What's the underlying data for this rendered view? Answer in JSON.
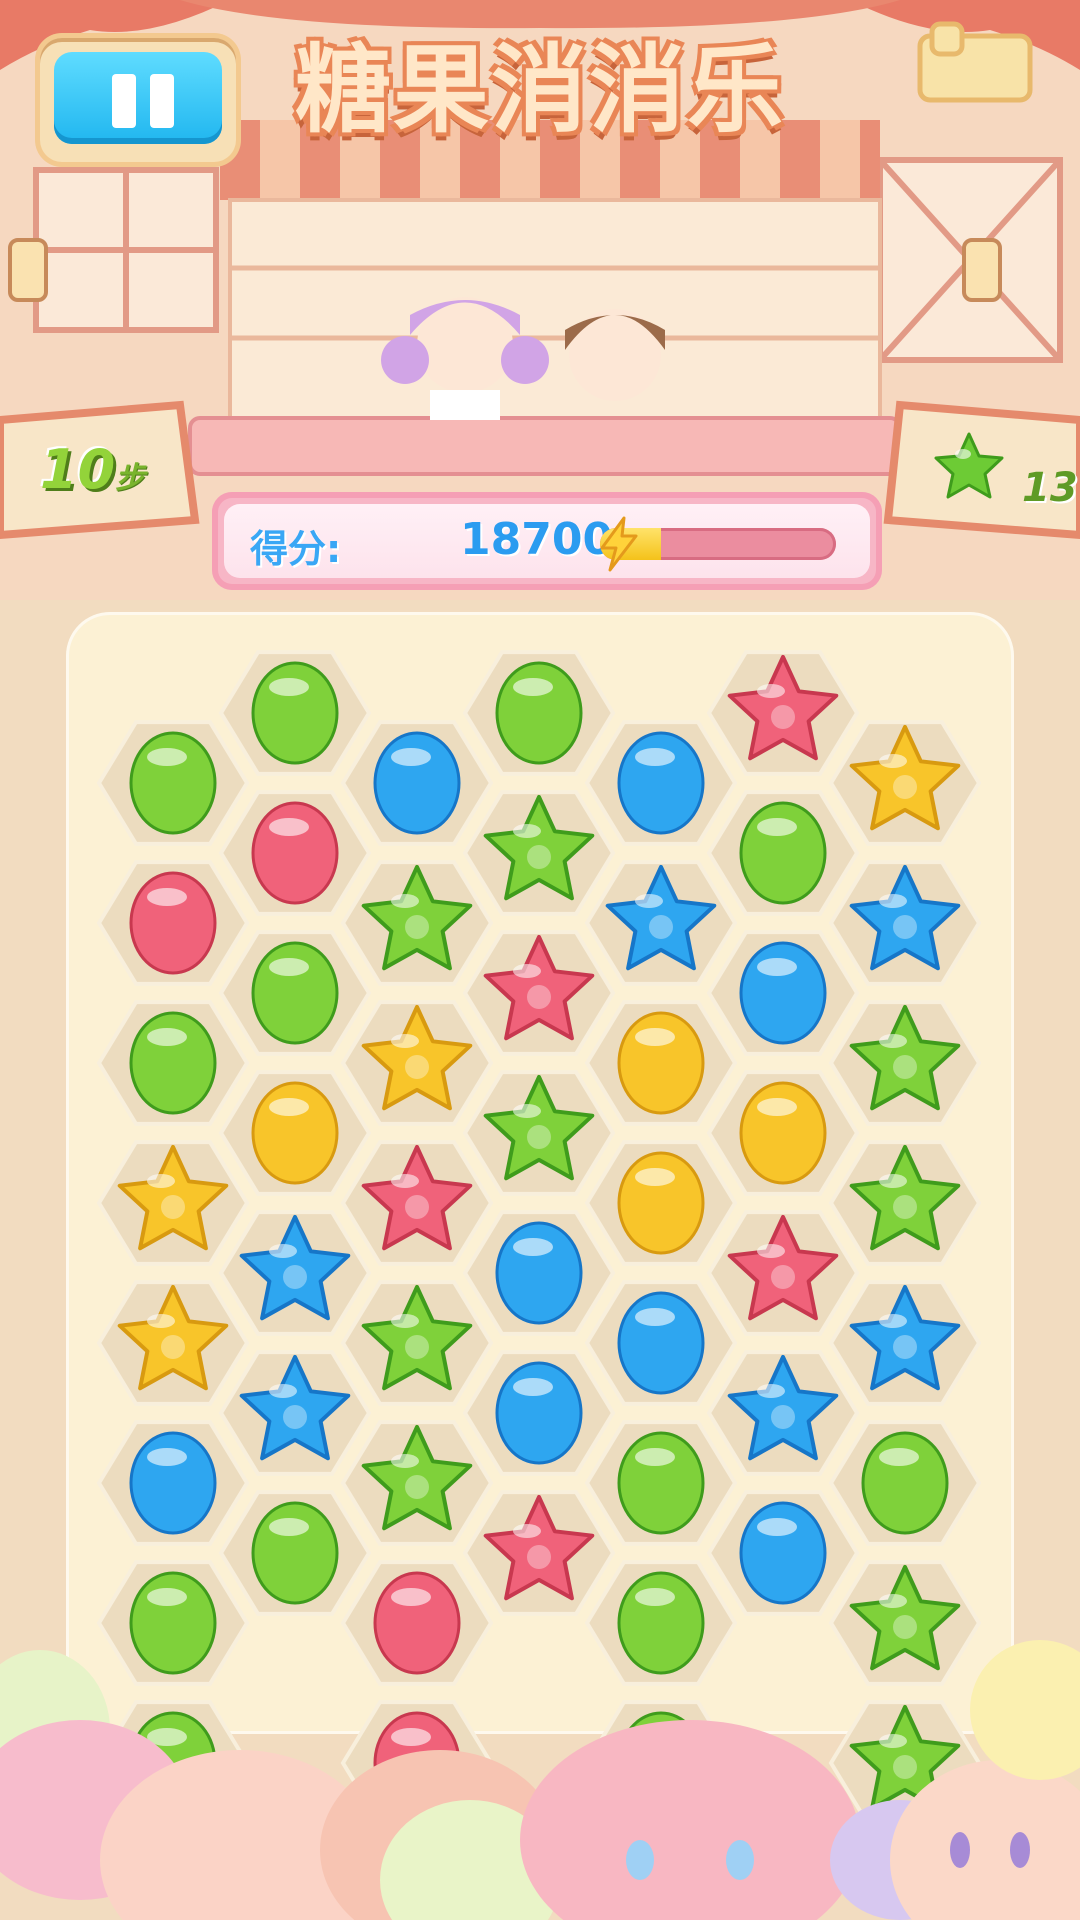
{
  "hud": {
    "title": "糖果消消乐",
    "steps_value": "10",
    "steps_unit": "步",
    "score_label": "得分:",
    "score_value": "18700",
    "goal_count": "13",
    "goal_icon": "green-star-candy-icon",
    "energy_level": 0.26
  },
  "board": {
    "columns": 7,
    "rows": 8,
    "candy_types": {
      "G": "green-round-candy",
      "B": "blue-round-candy",
      "R": "red-round-candy",
      "Y": "yellow-round-candy",
      "g": "green-star-candy",
      "b": "blue-star-candy",
      "r": "red-star-candy",
      "y": "yellow-star-candy"
    },
    "colors": {
      "green": "#7fd13a",
      "blue": "#2ea6f0",
      "red": "#f0627a",
      "yellow": "#f8c52a"
    },
    "grid": [
      [
        "G",
        "G",
        "B",
        "G",
        "B",
        "r",
        "y"
      ],
      [
        "R",
        "R",
        "g",
        "g",
        "b",
        "G",
        "b"
      ],
      [
        "G",
        "G",
        "y",
        "r",
        "Y",
        "B",
        "g"
      ],
      [
        "y",
        "Y",
        "r",
        "g",
        "Y",
        "Y",
        "g"
      ],
      [
        "y",
        "b",
        "g",
        "B",
        "B",
        "r",
        "b"
      ],
      [
        "B",
        "b",
        "g",
        "B",
        "G",
        "b",
        "G"
      ],
      [
        "G",
        "G",
        "R",
        "r",
        "G",
        "B",
        "g"
      ]
    ]
  }
}
